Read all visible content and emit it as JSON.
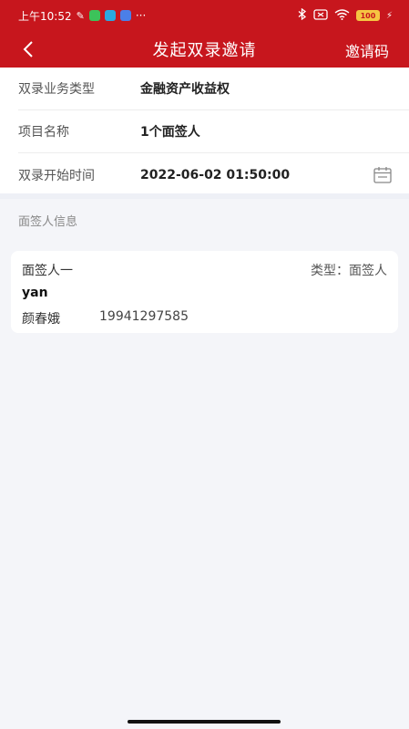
{
  "status_bar": {
    "time": "上午10:52",
    "more": "···",
    "battery": "100"
  },
  "nav": {
    "title": "发起双录邀请",
    "action": "邀请码",
    "back_icon": "chevron-left-icon"
  },
  "form": {
    "rows": [
      {
        "label": "双录业务类型",
        "value": "金融资产收益权"
      },
      {
        "label": "项目名称",
        "value": "1个面签人"
      },
      {
        "label": "双录开始时间",
        "value": "2022-06-02 01:50:00"
      }
    ],
    "calendar_icon": "calendar-icon"
  },
  "signers": {
    "title": "面签人信息",
    "items": [
      {
        "heading": "面签人一",
        "type": "类型：面签人",
        "username": "yan",
        "name": "颜春娥",
        "phone": "19941297585"
      }
    ]
  },
  "colors": {
    "brand_red": "#c7161d",
    "background": "#f4f5f9"
  }
}
